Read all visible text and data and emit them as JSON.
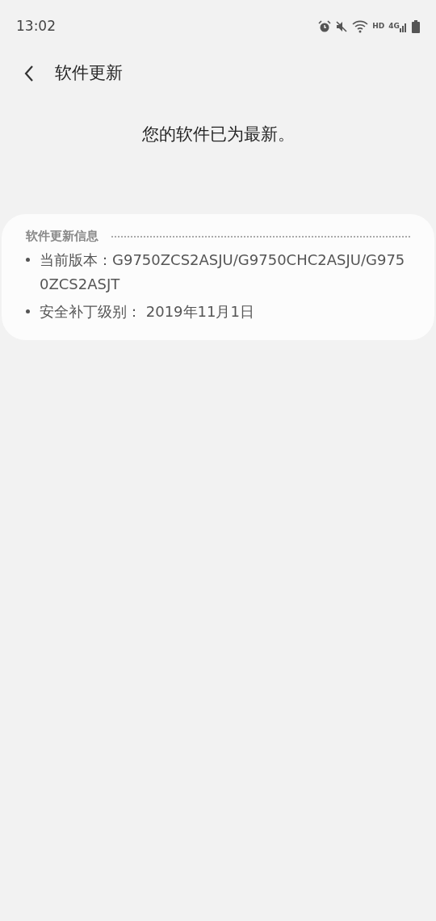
{
  "status_bar": {
    "time": "13:02",
    "hd": "HD",
    "network": "4G"
  },
  "header": {
    "title": "软件更新"
  },
  "message": "您的软件已为最新。",
  "info_card": {
    "title": "软件更新信息",
    "items": [
      {
        "text": "当前版本：G9750ZCS2ASJU/G9750CHC2ASJU/G9750ZCS2ASJT"
      },
      {
        "text": "安全补丁级别： 2019年11月1日"
      }
    ]
  }
}
